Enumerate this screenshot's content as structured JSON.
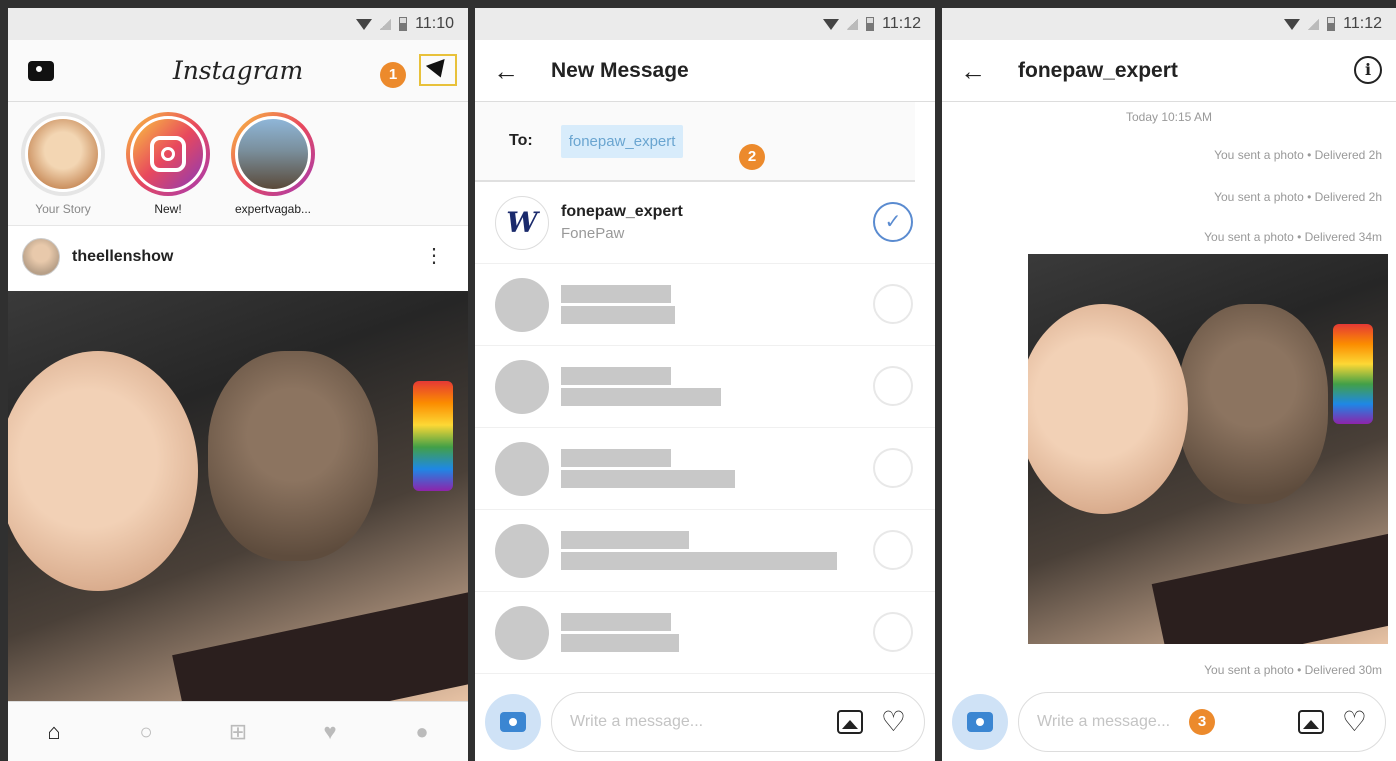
{
  "screen1": {
    "status_time": "11:10",
    "logo": "Instagram",
    "badge": "1",
    "stories": [
      {
        "label": "Your Story"
      },
      {
        "label": "New!"
      },
      {
        "label": "expertvagab..."
      }
    ],
    "post_user": "theellenshow",
    "kebab": "⋮",
    "nav": [
      "home-icon",
      "search-icon",
      "add-icon",
      "heart-icon",
      "profile-icon"
    ]
  },
  "screen2": {
    "status_time": "11:12",
    "back": "←",
    "title": "New Message",
    "to_label": "To:",
    "chip": "fonepaw_expert",
    "badge": "2",
    "contact": {
      "name": "fonepaw_expert",
      "sub": "FonePaw",
      "avatar_glyph": "W"
    },
    "placeholder": "Write a message..."
  },
  "screen3": {
    "status_time": "11:12",
    "back": "←",
    "title": "fonepaw_expert",
    "info": "i",
    "timestamp": "Today 10:15 AM",
    "delivered": [
      "You sent a photo • Delivered 2h",
      "You sent a photo • Delivered 2h",
      "You sent a photo • Delivered 34m",
      "You sent a photo • Delivered 30m"
    ],
    "placeholder": "Write a message...",
    "badge": "3"
  },
  "colors": {
    "badge": "#ec8a2c",
    "chip_bg": "#d8ecfb",
    "accent": "#3b86d2"
  }
}
